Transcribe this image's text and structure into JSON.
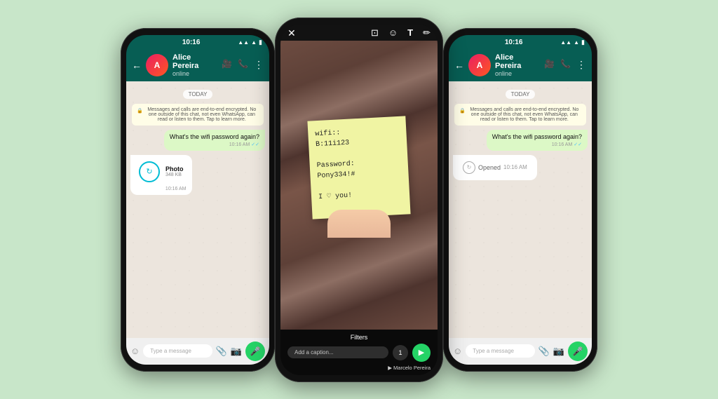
{
  "background_color": "#c8e6c9",
  "phones": {
    "left": {
      "status_bar": {
        "time": "10:16",
        "signal_icon": "▲▲▲",
        "wifi_icon": "▲",
        "battery_icon": "▮"
      },
      "header": {
        "back_label": "←",
        "contact_name": "Alice Pereira",
        "status": "online",
        "video_icon": "📹",
        "call_icon": "📞",
        "menu_icon": "⋮"
      },
      "chat": {
        "date_badge": "TODAY",
        "encryption_notice": "🔒 Messages and calls are end-to-end encrypted. No one outside of this chat, not even WhatsApp, can read or listen to them. Tap to learn more.",
        "sent_message": "What's the wifi password again?",
        "sent_time": "10:16 AM",
        "photo_label": "Photo",
        "photo_size": "348 KB",
        "photo_time": "10:16 AM"
      },
      "input_bar": {
        "placeholder": "Type a message",
        "emoji_icon": "☺",
        "attach_icon": "📎",
        "camera_icon": "📷",
        "mic_icon": "🎤"
      }
    },
    "middle": {
      "status_bar": {
        "close_icon": "✕"
      },
      "tools": {
        "crop_icon": "⊡",
        "emoji_icon": "☺",
        "text_icon": "T",
        "draw_icon": "✏"
      },
      "sticky_note": {
        "content": "wifi::\nB:11i123\n\nPassword:\nPony334!#\n\nI ♡ you!"
      },
      "filters_label": "Filters",
      "caption_placeholder": "Add a caption...",
      "contact_label": "▶ Marcelo Pereira",
      "send_icon": "▶"
    },
    "right": {
      "status_bar": {
        "time": "10:16",
        "signal_icon": "▲▲▲",
        "wifi_icon": "▲",
        "battery_icon": "▮"
      },
      "header": {
        "back_label": "←",
        "contact_name": "Alice Pereira",
        "status": "online",
        "video_icon": "📹",
        "call_icon": "📞",
        "menu_icon": "⋮"
      },
      "chat": {
        "date_badge": "TODAY",
        "encryption_notice": "🔒 Messages and calls are end-to-end encrypted. No one outside of this chat, not even WhatsApp, can read or listen to them. Tap to learn more.",
        "sent_message": "What's the wifi password again?",
        "sent_time": "10:16 AM",
        "opened_label": "Opened",
        "opened_time": "10:16 AM"
      },
      "input_bar": {
        "placeholder": "Type a message",
        "emoji_icon": "☺",
        "attach_icon": "📎",
        "camera_icon": "📷",
        "mic_icon": "🎤"
      }
    }
  }
}
